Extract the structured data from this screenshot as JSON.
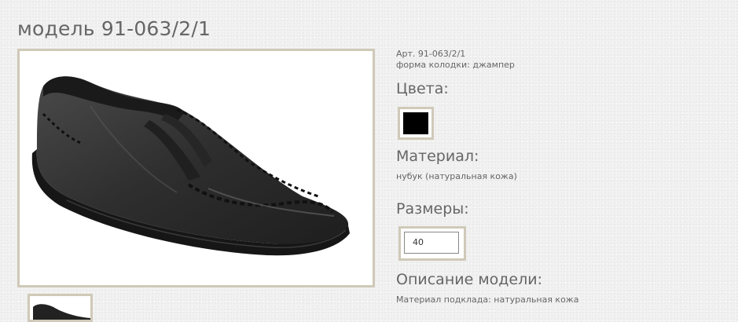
{
  "product": {
    "title": "модель 91-063/2/1",
    "article": "Арт. 91-063/2/1",
    "last_shape": "форма колодки: джампер",
    "colors_heading": "Цвета:",
    "color_swatch": "#000000",
    "material_heading": "Материал:",
    "material_value": "нубук (натуральная кожа)",
    "sizes_heading": "Размеры:",
    "size_value": "40",
    "description_heading": "Описание модели:",
    "description_text": "Материал подклада: натуральная кожа"
  },
  "colors": {
    "frame": "#cfc9b8",
    "shoe": "#2b2b2b"
  }
}
